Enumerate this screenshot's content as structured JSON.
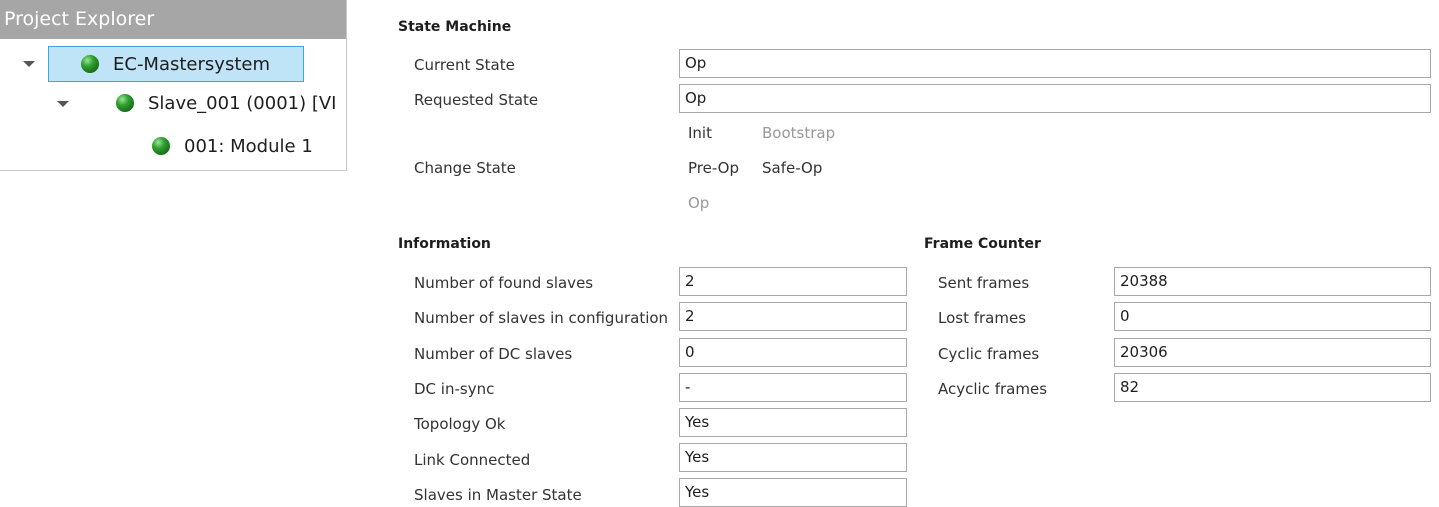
{
  "explorer": {
    "title": "Project Explorer",
    "nodes": [
      {
        "label": "EC-Mastersystem"
      },
      {
        "label": "Slave_001 (0001) [VI"
      },
      {
        "label": "001: Module 1"
      }
    ]
  },
  "state_machine": {
    "title": "State Machine",
    "current_state_label": "Current State",
    "current_state_value": "Op",
    "requested_state_label": "Requested State",
    "requested_state_value": "Op",
    "change_state_label": "Change State",
    "buttons": {
      "init": "Init",
      "bootstrap": "Bootstrap",
      "pre_op": "Pre-Op",
      "safe_op": "Safe-Op",
      "op": "Op"
    }
  },
  "information": {
    "title": "Information",
    "rows": [
      {
        "label": "Number of found slaves",
        "value": "2"
      },
      {
        "label": "Number of slaves in configuration",
        "value": "2"
      },
      {
        "label": "Number of DC slaves",
        "value": "0"
      },
      {
        "label": "DC in-sync",
        "value": "-"
      },
      {
        "label": "Topology Ok",
        "value": "Yes"
      },
      {
        "label": "Link Connected",
        "value": "Yes"
      },
      {
        "label": "Slaves in Master State",
        "value": "Yes"
      }
    ]
  },
  "frame_counter": {
    "title": "Frame Counter",
    "rows": [
      {
        "label": "Sent frames",
        "value": "20388"
      },
      {
        "label": "Lost frames",
        "value": "0"
      },
      {
        "label": "Cyclic frames",
        "value": "20306"
      },
      {
        "label": "Acyclic frames",
        "value": "82"
      }
    ]
  },
  "colors": {
    "header_bg": "#a6a6a6",
    "selection_bg": "#bfe3f7",
    "selection_border": "#3ea6de",
    "status_ball": "#2fa02f",
    "disabled_text": "#999999"
  },
  "icons": [
    "expand-arrow-icon",
    "status-green-ball-icon"
  ]
}
